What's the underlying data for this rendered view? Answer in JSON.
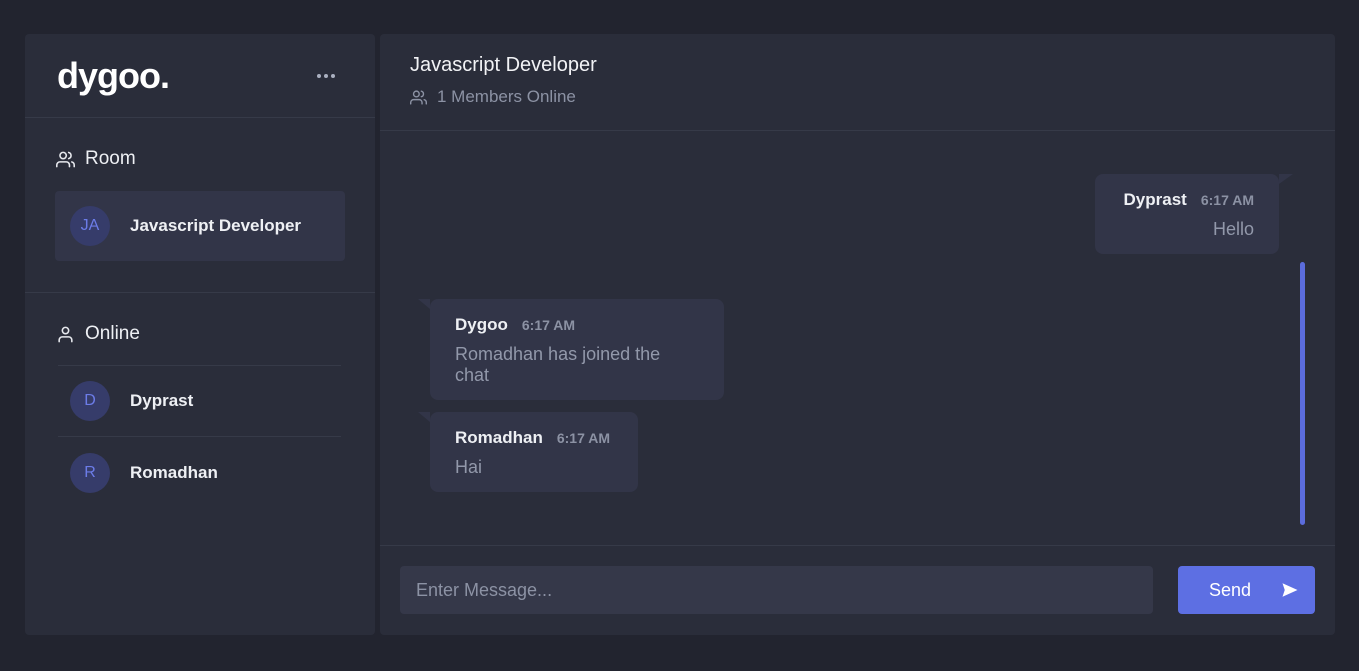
{
  "brand": {
    "logo": "dygoo."
  },
  "sidebar": {
    "room_title": "Room",
    "rooms": [
      {
        "initials": "JA",
        "name": "Javascript Developer"
      }
    ],
    "online_title": "Online",
    "users": [
      {
        "initial": "D",
        "name": "Dyprast"
      },
      {
        "initial": "R",
        "name": "Romadhan"
      }
    ]
  },
  "chat": {
    "title": "Javascript Developer",
    "members_online": "1 Members Online",
    "messages": [
      {
        "author": "Dyprast",
        "time": "6:17 AM",
        "text": "Hello",
        "side": "right"
      },
      {
        "author": "Dygoo",
        "time": "6:17 AM",
        "text": "Romadhan has joined the chat",
        "side": "left"
      },
      {
        "author": "Romadhan",
        "time": "6:17 AM",
        "text": "Hai",
        "side": "left"
      }
    ],
    "input_placeholder": "Enter Message...",
    "send_label": "Send"
  },
  "colors": {
    "accent": "#5d6fe3",
    "background": "#22242f",
    "panel": "#2a2d3a",
    "bubble": "#323548"
  },
  "icons": [
    "more-icon",
    "users-icon",
    "user-icon",
    "send-icon"
  ]
}
